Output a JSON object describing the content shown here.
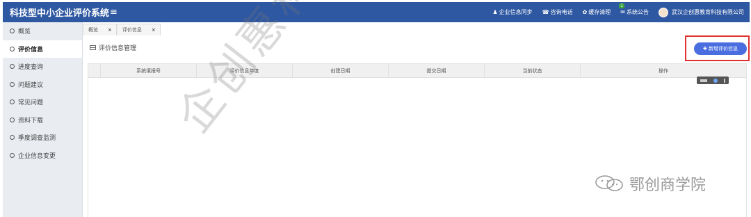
{
  "header": {
    "brand": "科技型中小企业评价系统",
    "hamburger_icon": "menu-icon",
    "items": [
      {
        "icon": "user-icon",
        "glyph": "♟",
        "label": "企业信息同步"
      },
      {
        "icon": "phone-icon",
        "glyph": "☎",
        "label": "咨询电话"
      },
      {
        "icon": "gear-icon",
        "glyph": "✿",
        "label": "缓存清理"
      },
      {
        "icon": "notice-icon",
        "glyph": "✉",
        "label": "系统公告",
        "badge": "1"
      }
    ],
    "user": {
      "avatar_icon": "avatar",
      "name": "武汉企创惠教育科技有限公司"
    }
  },
  "sidebar": {
    "items": [
      {
        "label": "概览",
        "active": false
      },
      {
        "label": "评价信息",
        "active": true
      },
      {
        "label": "进度查询",
        "active": false
      },
      {
        "label": "问题建议",
        "active": false
      },
      {
        "label": "常见问题",
        "active": false
      },
      {
        "label": "资料下载",
        "active": false
      },
      {
        "label": "季度调查监测",
        "active": false
      },
      {
        "label": "企业信息变更",
        "active": false
      }
    ]
  },
  "tabs": [
    {
      "label": "概览",
      "close": "×"
    },
    {
      "label": "评价信息",
      "close": "×"
    }
  ],
  "main": {
    "title": "评价信息管理",
    "add_button": "✚ 新增评价信息",
    "columns": [
      "",
      "系统填报号",
      "评价信息年度",
      "创建日期",
      "提交日期",
      "当前状态",
      "操作"
    ]
  },
  "watermark": {
    "diagonal": "企创惠科技咨询",
    "wechat": "鄂创商学院"
  },
  "colors": {
    "topbar": "#2f58a2",
    "accent_button": "#4a6ee0",
    "highlight": "#e03131"
  }
}
